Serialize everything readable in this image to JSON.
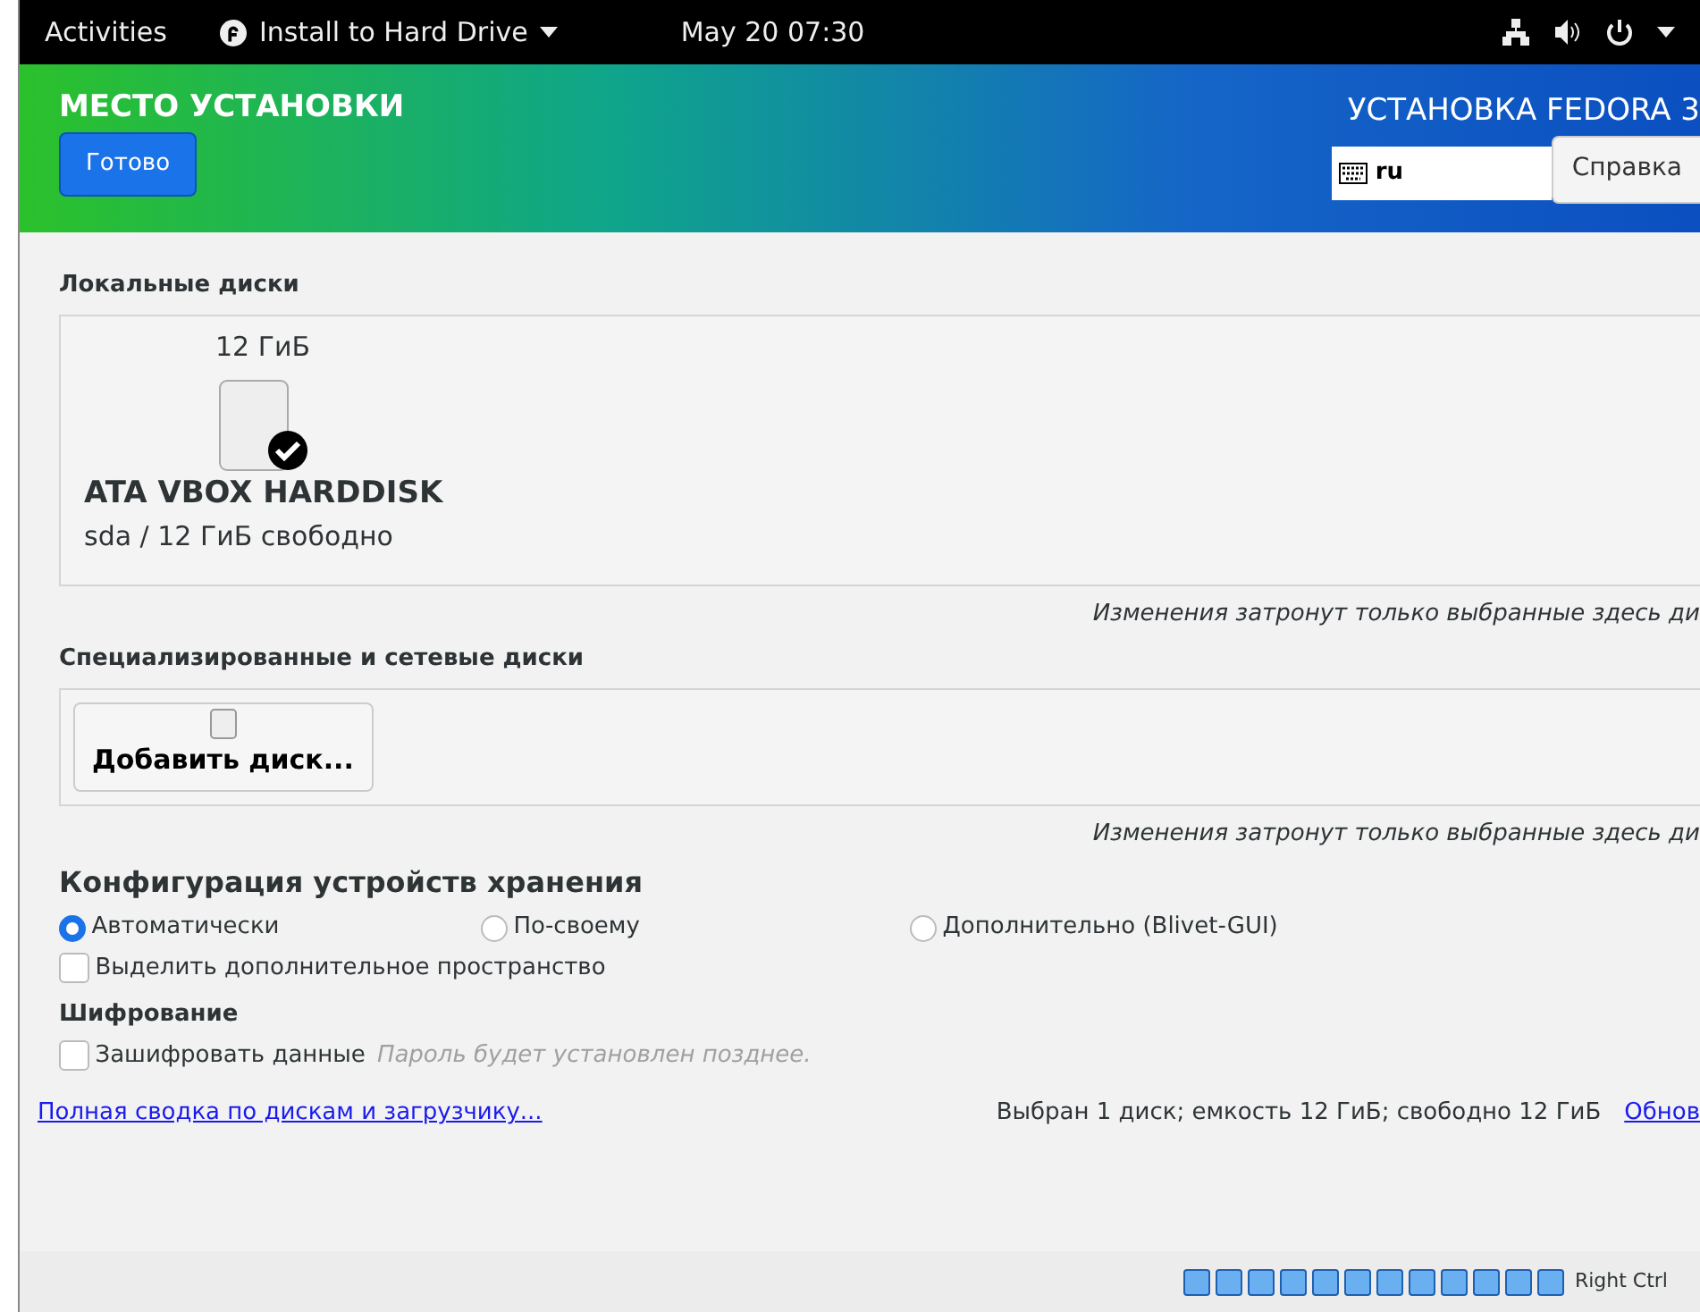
{
  "top_bar": {
    "activities": "Activities",
    "app_menu": "Install to Hard Drive",
    "clock": "May 20  07:30"
  },
  "header": {
    "title": "МЕСТО УСТАНОВКИ",
    "done_button": "Готово",
    "product": "УСТАНОВКА FEDORA 3",
    "keyboard_layout": "ru",
    "help_button": "Справка"
  },
  "local_disks": {
    "heading": "Локальные диски",
    "disks": [
      {
        "size": "12 ГиБ",
        "name": "ATA VBOX HARDDISK",
        "details": "sda  /  12 ГиБ свободно",
        "selected": true
      }
    ],
    "note": "Изменения затронут только выбранные здесь ди"
  },
  "network_disks": {
    "heading": "Специализированные и сетевые диски",
    "add_button": "Добавить диск...",
    "note": "Изменения затронут только выбранные здесь ди"
  },
  "storage_config": {
    "heading": "Конфигурация устройств хранения",
    "options": [
      {
        "label": "Автоматически",
        "selected": true
      },
      {
        "label": "По-своему",
        "selected": false
      },
      {
        "label": "Дополнительно (Blivet-GUI)",
        "selected": false
      }
    ],
    "reclaim": {
      "label": "Выделить дополнительное пространство",
      "checked": false
    }
  },
  "encryption": {
    "heading": "Шифрование",
    "encrypt": {
      "label": "Зашифровать данные",
      "checked": false
    },
    "hint": "Пароль будет установлен позднее."
  },
  "footer": {
    "summary_link": "Полная сводка по дискам и загрузчику...",
    "status": "Выбран 1 диск; емкость 12 ГиБ; свободно 12 ГиБ",
    "refresh_link": "Обнов"
  },
  "vm_status_bar": {
    "host_key": "Right Ctrl"
  }
}
